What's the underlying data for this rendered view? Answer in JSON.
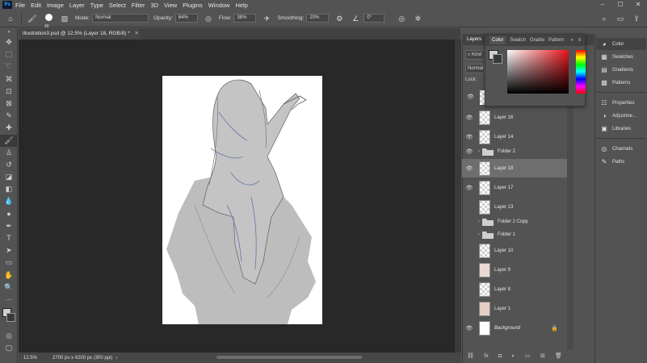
{
  "menubar": {
    "logo": "Ps",
    "items": [
      "File",
      "Edit",
      "Image",
      "Layer",
      "Type",
      "Select",
      "Filter",
      "3D",
      "View",
      "Plugins",
      "Window",
      "Help"
    ],
    "window_controls": [
      "–",
      "☐",
      "✕"
    ]
  },
  "options": {
    "brush_size": "40",
    "mode_label": "Mode:",
    "mode_value": "Normal",
    "opacity_label": "Opacity:",
    "opacity_value": "64%",
    "flow_label": "Flow:",
    "flow_value": "38%",
    "smoothing_label": "Smoothing:",
    "smoothing_value": "20%",
    "angle_value": "0°"
  },
  "document": {
    "tab_title": "illustration3.psd @ 12.5% (Layer 18, RGB/8) *",
    "zoom": "12.5%",
    "dimensions": "2700 px x 4200 px (300 ppi)"
  },
  "layers_panel": {
    "tabs": [
      "Layers",
      "Color",
      "Swatch",
      "Gradie",
      "Pattern"
    ],
    "kind_label": "Kind",
    "blend_mode": "Normal",
    "lock_label": "Lock:",
    "layers": [
      {
        "name": "Layer 16",
        "visible": true,
        "type": "layer"
      },
      {
        "name": "Layer 14",
        "visible": true,
        "type": "layer"
      },
      {
        "name": "Folder 2",
        "visible": true,
        "type": "folder"
      },
      {
        "name": "Layer 18",
        "visible": true,
        "type": "layer",
        "selected": true
      },
      {
        "name": "Layer 17",
        "visible": true,
        "type": "layer"
      },
      {
        "name": "Layer 13",
        "visible": false,
        "type": "layer"
      },
      {
        "name": "Folder 2 Copy",
        "visible": false,
        "type": "folder"
      },
      {
        "name": "Folder 1",
        "visible": false,
        "type": "folder"
      },
      {
        "name": "Layer 10",
        "visible": false,
        "type": "layer"
      },
      {
        "name": "Layer 9",
        "visible": false,
        "type": "layer"
      },
      {
        "name": "Layer 8",
        "visible": false,
        "type": "layer"
      },
      {
        "name": "Layer 1",
        "visible": false,
        "type": "layer"
      },
      {
        "name": "Background",
        "visible": true,
        "type": "background"
      }
    ]
  },
  "color_panel": {
    "tabs": [
      "Color",
      "Swatch",
      "Gradie",
      "Pattern"
    ]
  },
  "right_dock": {
    "group1": [
      "Color",
      "Swatches",
      "Gradients",
      "Patterns"
    ],
    "group2": [
      "Properties",
      "Adjustme...",
      "Libraries"
    ],
    "group3": [
      "Channels",
      "Paths"
    ]
  },
  "colors": {
    "ui_bg": "#535353",
    "canvas_bg": "#282828",
    "selected_row": "#6e6e6e",
    "ps_blue": "#31a8ff"
  }
}
